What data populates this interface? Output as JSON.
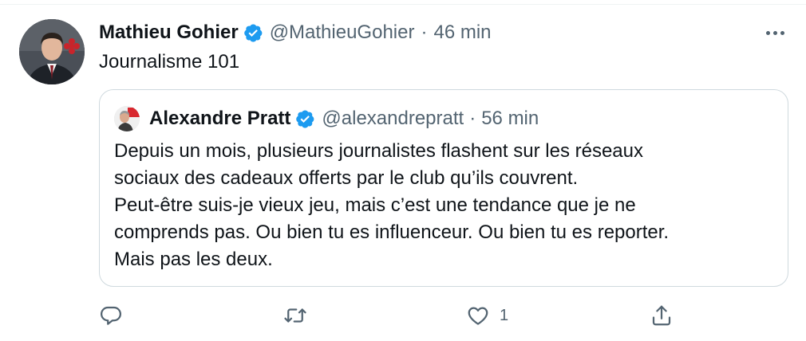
{
  "tweet": {
    "author_name": "Mathieu Gohier",
    "author_handle": "@MathieuGohier",
    "separator": "·",
    "time": "46 min",
    "text": "Journalisme 101"
  },
  "quoted": {
    "author_name": "Alexandre Pratt",
    "author_handle": "@alexandrepratt",
    "separator": "·",
    "time": "56 min",
    "lines": [
      "Depuis un mois, plusieurs journalistes flashent sur les réseaux",
      "sociaux des cadeaux offerts par le club qu’ils couvrent.",
      "Peut-être suis-je vieux jeu, mais c’est une tendance que je ne",
      "comprends pas. Ou bien tu es influenceur. Ou bien tu es reporter.",
      "Mais pas les deux."
    ]
  },
  "actions": {
    "reply_icon": "reply-icon",
    "retweet_icon": "retweet-icon",
    "like_icon": "heart-icon",
    "like_count": "1",
    "share_icon": "share-icon"
  },
  "colors": {
    "verified": "#1d9bf0",
    "secondary_text": "#536471",
    "border": "#cfd9de"
  }
}
